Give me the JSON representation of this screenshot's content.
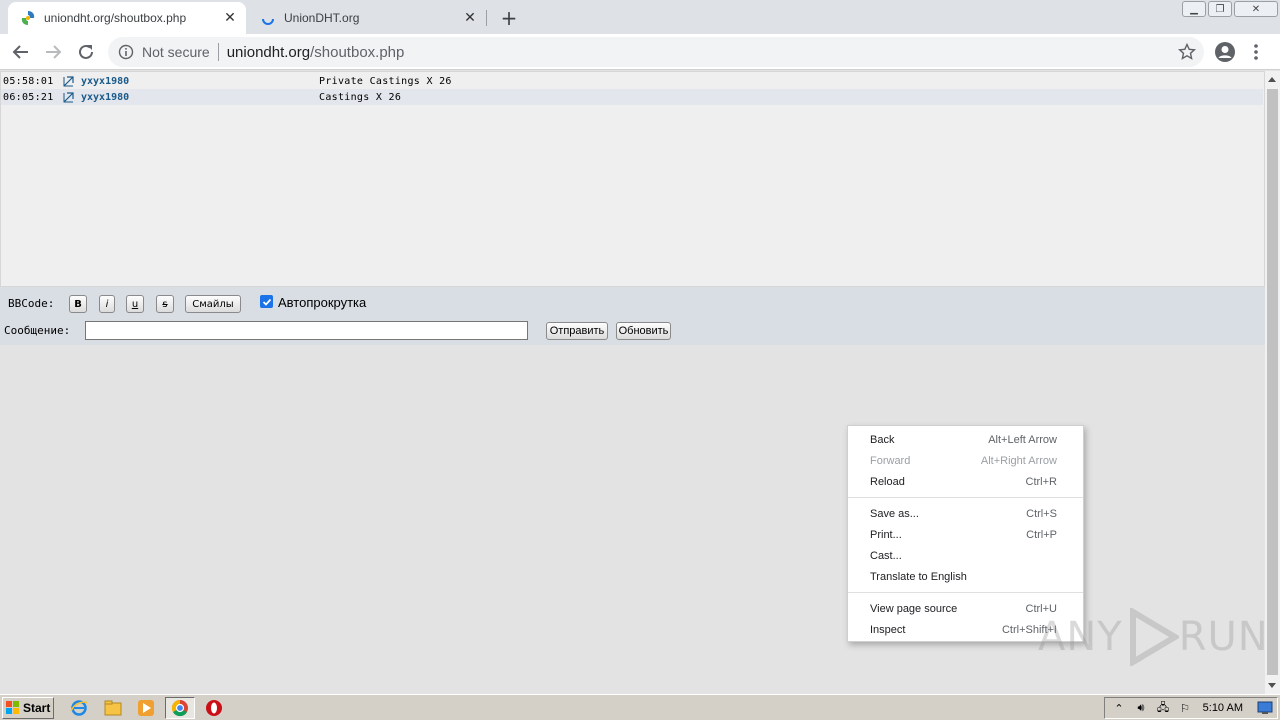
{
  "browser": {
    "tabs": [
      {
        "title": "uniondht.org/shoutbox.php",
        "active": true
      },
      {
        "title": "UnionDHT.org",
        "active": false
      }
    ],
    "new_tab": "+",
    "tab_close": "✕",
    "window_controls": {
      "minimize": "▁",
      "restore": "❐",
      "close": "✕"
    },
    "security": "Not secure",
    "url_host": "uniondht.org",
    "url_path": "/shoutbox.php"
  },
  "shoutbox": {
    "messages": [
      {
        "time": "05:58:01",
        "nick": "yxyx1980",
        "text": "Private Castings X 26"
      },
      {
        "time": "06:05:21",
        "nick": "yxyx1980",
        "text": "Castings X 26"
      }
    ],
    "bbcode_label": "BBCode:",
    "bbcode_buttons": {
      "bold": "B",
      "italic": "i",
      "underline": "u",
      "strike": "s"
    },
    "smileys_button": "Смайлы",
    "autoscroll_label": "Автопрокрутка",
    "autoscroll_checked": true,
    "message_label": "Сообщение:",
    "message_value": "",
    "send_button": "Отправить",
    "refresh_button": "Обновить"
  },
  "context_menu": {
    "items": [
      {
        "label": "Back",
        "shortcut": "Alt+Left Arrow",
        "disabled": false
      },
      {
        "label": "Forward",
        "shortcut": "Alt+Right Arrow",
        "disabled": true
      },
      {
        "label": "Reload",
        "shortcut": "Ctrl+R",
        "disabled": false
      },
      {
        "label": "Save as...",
        "shortcut": "Ctrl+S",
        "disabled": false
      },
      {
        "label": "Print...",
        "shortcut": "Ctrl+P",
        "disabled": false
      },
      {
        "label": "Cast...",
        "shortcut": "",
        "disabled": false
      },
      {
        "label": "Translate to English",
        "shortcut": "",
        "disabled": false
      },
      {
        "label": "View page source",
        "shortcut": "Ctrl+U",
        "disabled": false
      },
      {
        "label": "Inspect",
        "shortcut": "Ctrl+Shift+I",
        "disabled": false
      }
    ]
  },
  "watermark": {
    "left": "ANY",
    "right": "RUN"
  },
  "taskbar": {
    "start_label": "Start",
    "clock": "5:10 AM"
  },
  "colors": {
    "nick": "#1a5a8a",
    "accent": "#1a73e8",
    "page_bg": "#e3e3e3"
  }
}
